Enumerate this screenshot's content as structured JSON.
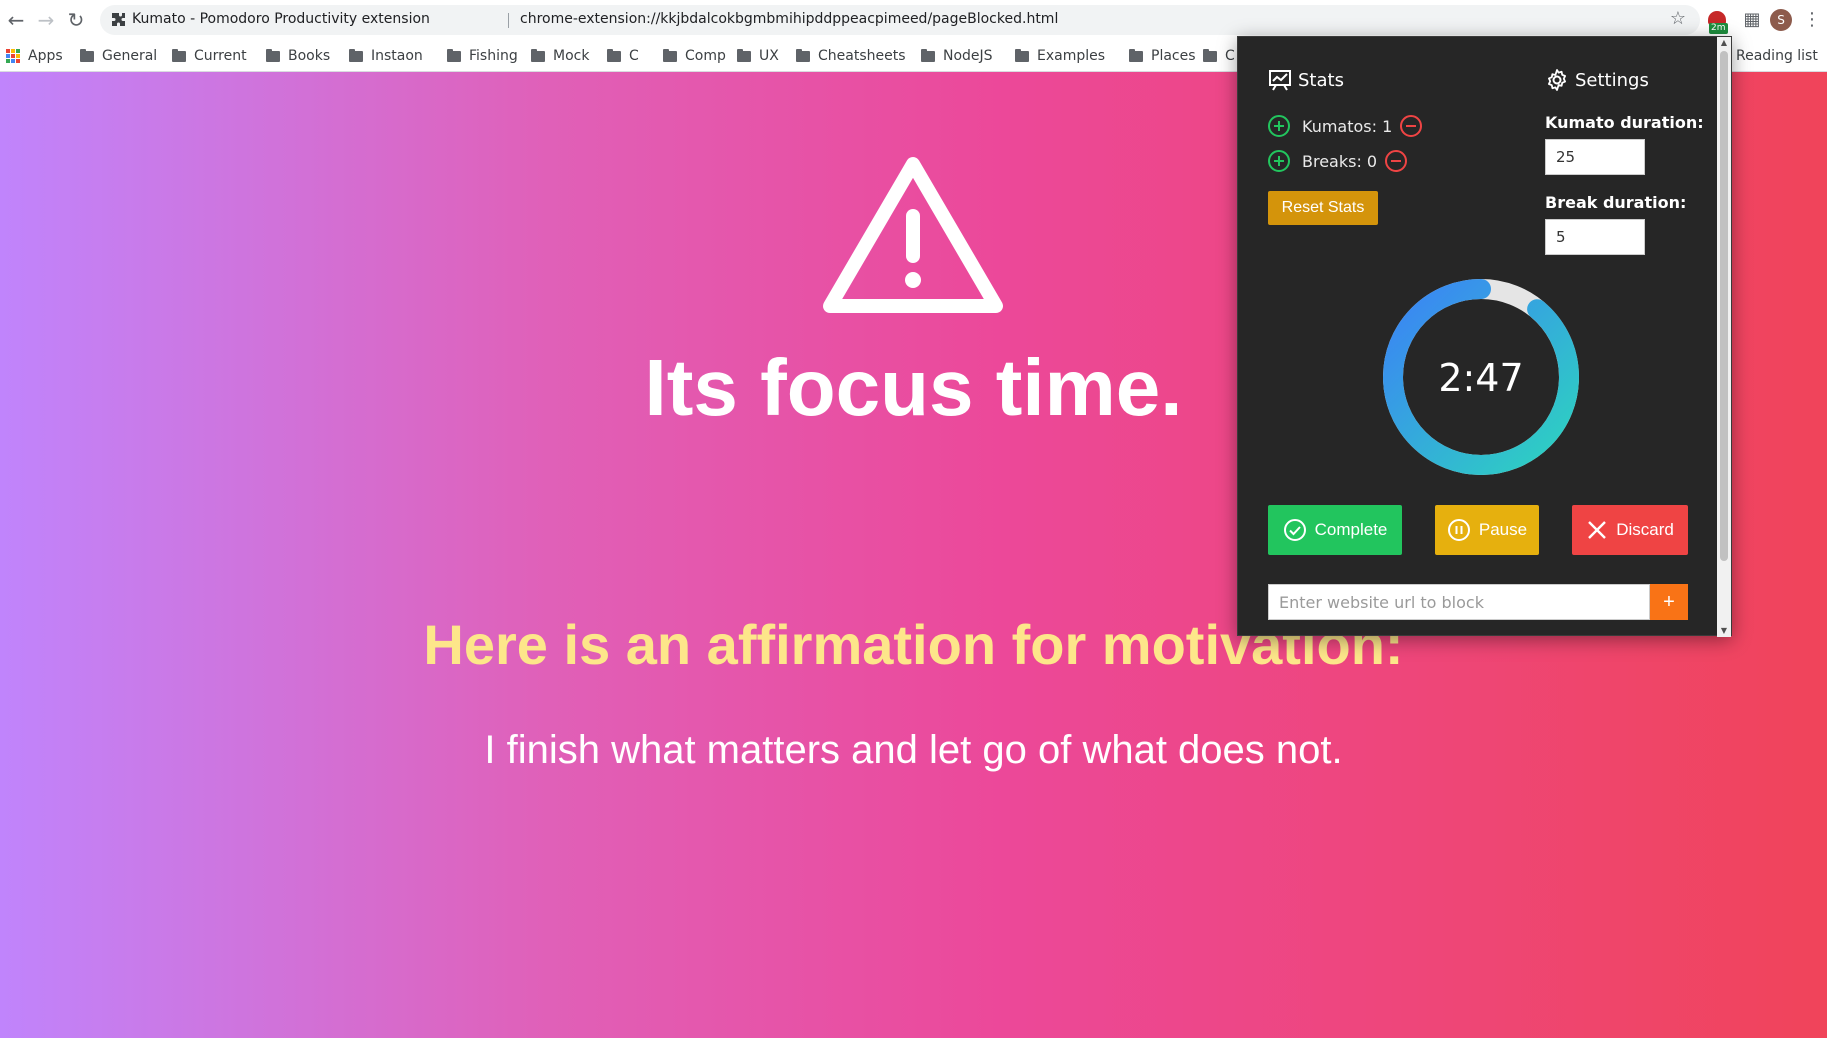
{
  "browser": {
    "tab_title": "Kumato - Pomodoro Productivity extension",
    "url": "chrome-extension://kkjbdalcokbgmbmihipddppeacpimeed/pageBlocked.html",
    "extension_badge": "2m",
    "avatar_letter": "S",
    "bookmarks": [
      "Apps",
      "General",
      "Current",
      "Books",
      "Instaon",
      "Fishing",
      "Mock",
      "C",
      "Comp",
      "UX",
      "Cheatsheets",
      "NodeJS",
      "Examples",
      "Places",
      "C"
    ],
    "reading_list": "Reading list"
  },
  "page": {
    "title": "Its focus time.",
    "affirmation_heading": "Here is an affirmation for motivation:",
    "affirmation": "I finish what matters and let go of what does not."
  },
  "popup": {
    "stats": {
      "heading": "Stats",
      "kumatos_label": "Kumatos: 1",
      "breaks_label": "Breaks: 0",
      "reset_label": "Reset Stats"
    },
    "settings": {
      "heading": "Settings",
      "kumato_duration_label": "Kumato duration:",
      "kumato_duration": "25",
      "break_duration_label": "Break duration:",
      "break_duration": "5"
    },
    "timer": {
      "display": "2:47",
      "progress_fraction": 0.89
    },
    "actions": {
      "complete": "Complete",
      "pause": "Pause",
      "discard": "Discard"
    },
    "block": {
      "placeholder": "Enter website url to block",
      "add_label": "+"
    }
  },
  "colors": {
    "gradient_start": "#c084fc",
    "gradient_end": "#f0445a",
    "affirmation_heading": "#fde68a",
    "popup_bg": "#262626",
    "complete": "#22c55e",
    "pause": "#e6b00e",
    "discard": "#ef4444",
    "reset": "#d4940b",
    "add": "#f97316"
  }
}
